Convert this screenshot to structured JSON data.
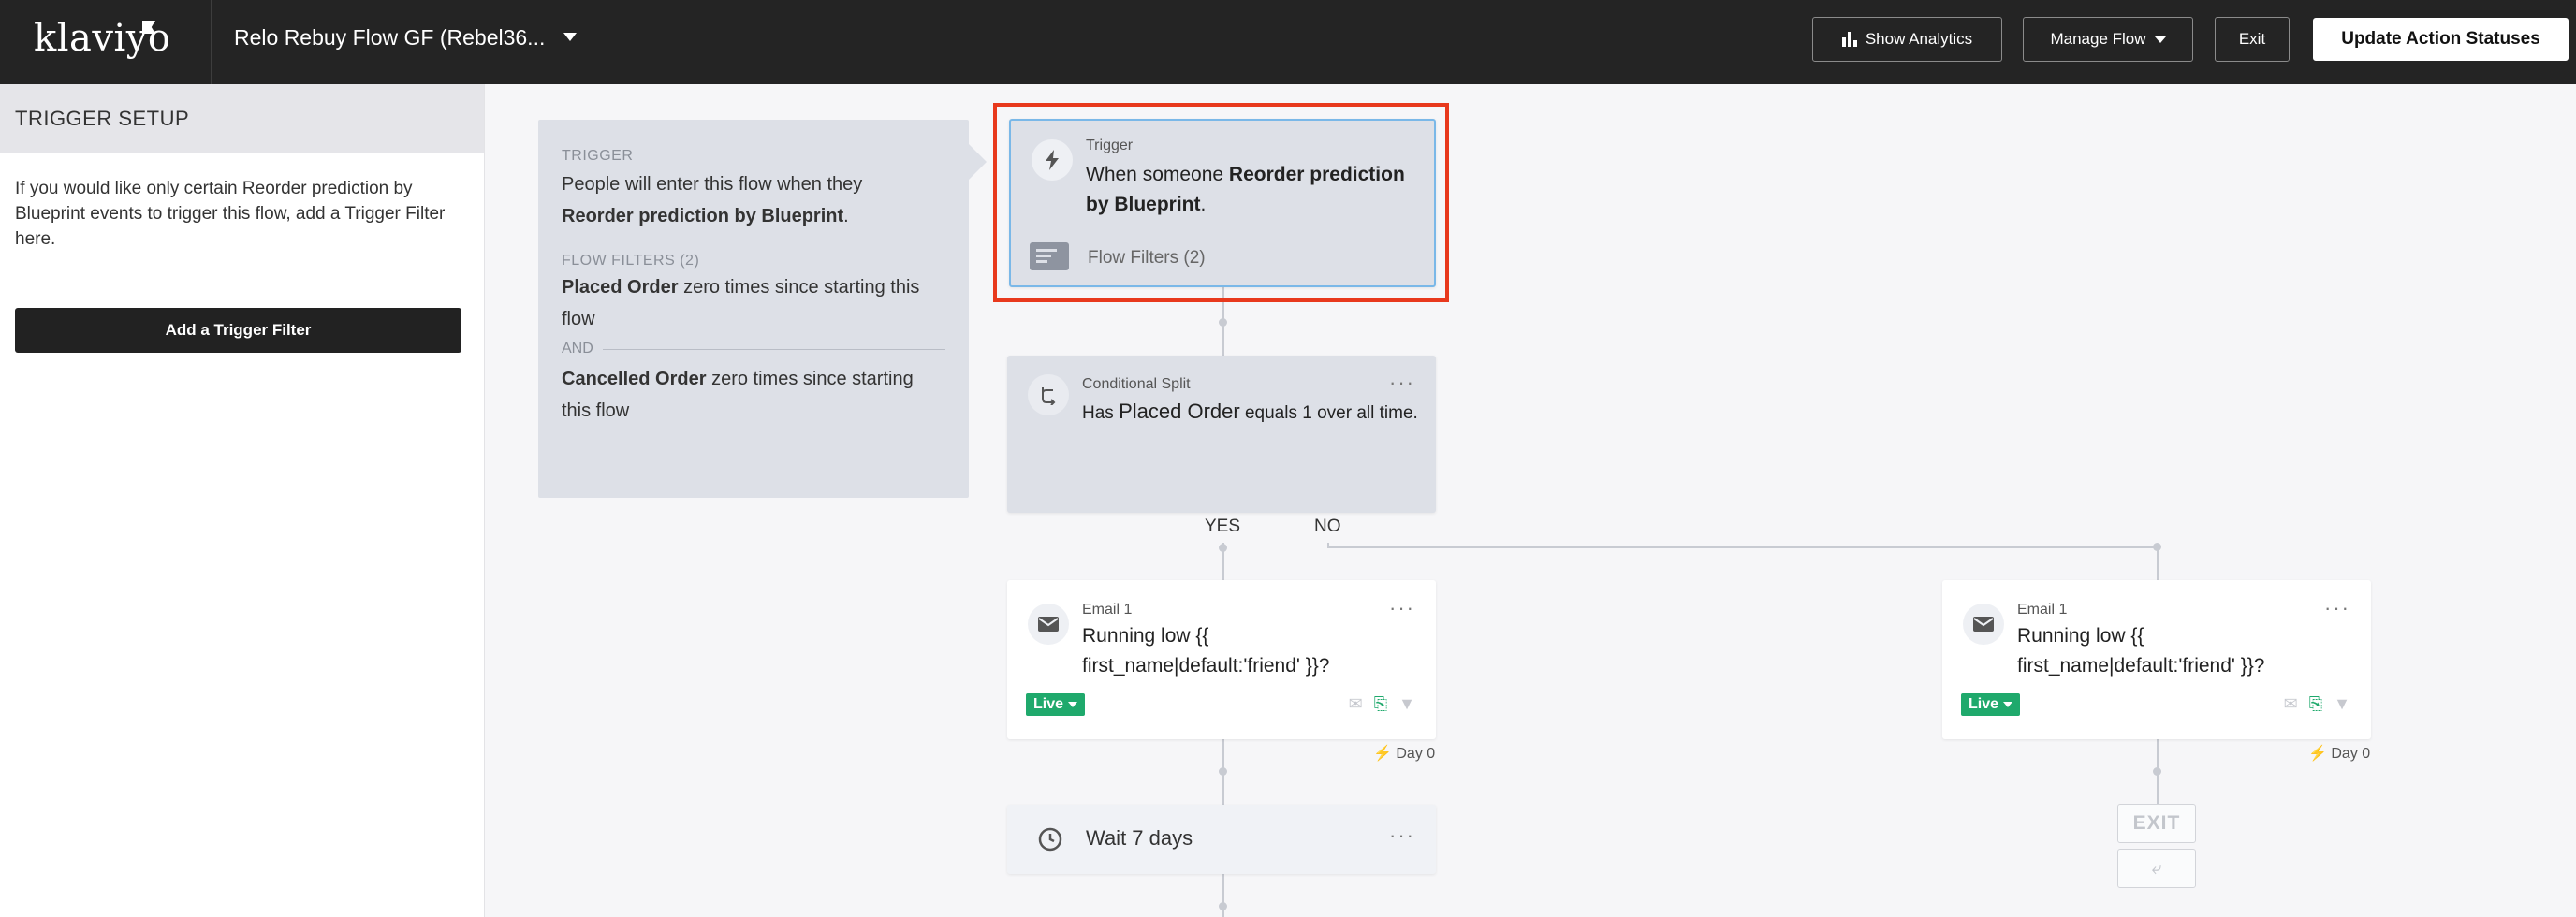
{
  "brand": {
    "logo": "klaviyo"
  },
  "topbar": {
    "flow_name": "Relo Rebuy Flow GF (Rebel36...",
    "show_analytics": "Show Analytics",
    "manage_flow": "Manage Flow",
    "exit": "Exit",
    "update_statuses": "Update Action Statuses"
  },
  "sidebar": {
    "heading": "TRIGGER SETUP",
    "description": "If you would like only certain Reorder prediction by Blueprint events to trigger this flow, add a Trigger Filter here.",
    "add_filter_button": "Add a Trigger Filter"
  },
  "info_panel": {
    "trigger_label": "TRIGGER",
    "trigger_text": "People will enter this flow when they",
    "trigger_event": "Reorder prediction by Blueprint",
    "trigger_period": ".",
    "filters_label": "FLOW FILTERS (2)",
    "filter1_metric": "Placed Order",
    "filter1_rest": " zero times since starting this flow",
    "and_label": "AND",
    "filter2_metric": "Cancelled Order",
    "filter2_rest": " zero times since starting this flow"
  },
  "trigger_node": {
    "label": "Trigger",
    "prefix": "When someone ",
    "event": "Reorder prediction by Blueprint",
    "suffix": ".",
    "filters": "Flow Filters (2)"
  },
  "split_node": {
    "label": "Conditional Split",
    "pre": "Has ",
    "metric": "Placed Order",
    "rest": " equals 1 over all time.",
    "yes": "YES",
    "no": "NO"
  },
  "email_yes": {
    "label": "Email 1",
    "subject": "Running low {{ first_name|default:'friend' }}?",
    "status": "Live",
    "day": "Day 0"
  },
  "email_no": {
    "label": "Email 1",
    "subject": "Running low {{ first_name|default:'friend' }}?",
    "status": "Live",
    "day": "Day 0"
  },
  "wait_node": {
    "text": "Wait 7 days"
  },
  "exit_node": {
    "label": "EXIT"
  },
  "colors": {
    "accent_live": "#1fa96c",
    "highlight": "#e8391d",
    "topbar": "#242424"
  },
  "icons": {
    "trigger": "lightning-icon",
    "split": "split-arrows-icon",
    "email": "envelope-icon",
    "wait": "clock-icon",
    "filters": "filter-list-icon"
  }
}
